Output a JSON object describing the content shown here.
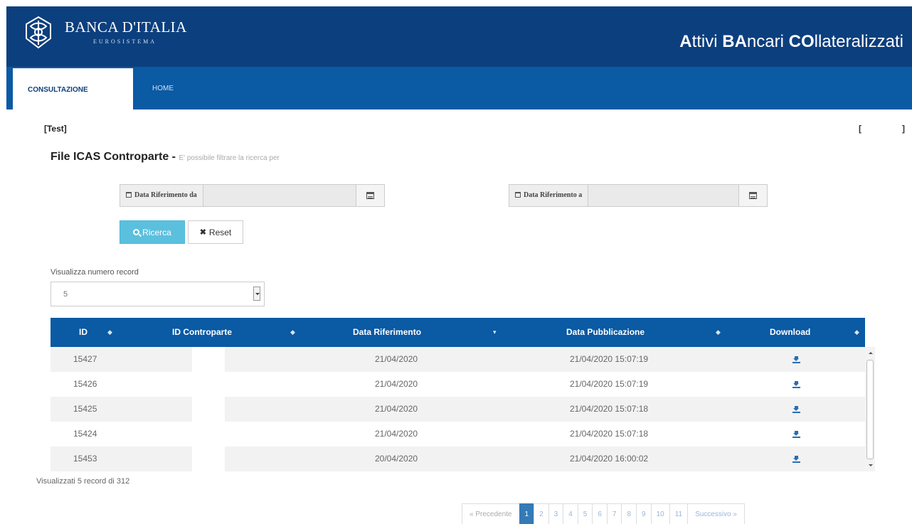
{
  "header": {
    "logo_title": "BANCA D'ITALIA",
    "logo_subtitle": "EUROSISTEMA",
    "app_title_parts": [
      "A",
      "ttivi ",
      "BA",
      "ncari ",
      "CO",
      "llateralizzati"
    ],
    "colors": {
      "header_bg": "#0c3f7e",
      "nav_bg": "#0a5aa4"
    }
  },
  "nav": {
    "tabs": [
      {
        "label": "CONSULTAZIONE",
        "active": true
      },
      {
        "label": "HOME",
        "active": false
      }
    ]
  },
  "context": {
    "env_label": "[Test]",
    "bracket_left": "[",
    "bracket_right": "]"
  },
  "section": {
    "title": "File ICAS Controparte - ",
    "hint": "E' possibile filtrare la ricerca per"
  },
  "filters": {
    "date_from_label": "Data Riferimento da",
    "date_from_value": "",
    "date_to_label": "Data Riferimento a",
    "date_to_value": "",
    "search_button": "Ricerca",
    "reset_button": "Reset"
  },
  "records": {
    "label": "Visualizza numero record",
    "selected": "5"
  },
  "table": {
    "columns": [
      "ID",
      "ID Controparte",
      "Data Riferimento",
      "Data Pubblicazione",
      "Download"
    ],
    "rows": [
      {
        "id": "15427",
        "controparte": "",
        "data_riferimento": "21/04/2020",
        "data_pubblicazione": "21/04/2020 15:07:19"
      },
      {
        "id": "15426",
        "controparte": "",
        "data_riferimento": "21/04/2020",
        "data_pubblicazione": "21/04/2020 15:07:19"
      },
      {
        "id": "15425",
        "controparte": "",
        "data_riferimento": "21/04/2020",
        "data_pubblicazione": "21/04/2020 15:07:18"
      },
      {
        "id": "15424",
        "controparte": "",
        "data_riferimento": "21/04/2020",
        "data_pubblicazione": "21/04/2020 15:07:18"
      },
      {
        "id": "15453",
        "controparte": "",
        "data_riferimento": "20/04/2020",
        "data_pubblicazione": "21/04/2020 16:00:02"
      }
    ]
  },
  "summary": "Visualizzati 5 record di 312",
  "pagination": {
    "prev": "« Precedente",
    "pages": [
      "1",
      "2",
      "3",
      "4",
      "5",
      "6",
      "7",
      "8",
      "9",
      "10",
      "11"
    ],
    "active_page": "1",
    "next": "Successivo »"
  }
}
